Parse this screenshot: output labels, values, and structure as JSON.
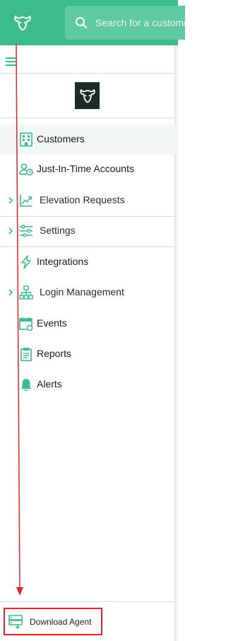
{
  "header": {
    "search_placeholder": "Search for a customer",
    "logo_icon": "bull-head-icon",
    "search_icon": "search-icon"
  },
  "sidebar": {
    "brand_logo": "bull-head-icon",
    "items": [
      {
        "label": "Customers",
        "icon": "building-grid-icon",
        "active": true,
        "expandable": false
      },
      {
        "label": "Just-In-Time Accounts",
        "icon": "user-clock-icon",
        "active": false,
        "expandable": false
      },
      {
        "label": "Elevation Requests",
        "icon": "chart-up-icon",
        "active": false,
        "expandable": true
      },
      {
        "label": "Settings",
        "icon": "sliders-icon",
        "active": false,
        "expandable": true
      },
      {
        "label": "Integrations",
        "icon": "lightning-icon",
        "active": false,
        "expandable": false
      },
      {
        "label": "Login Management",
        "icon": "hierarchy-icon",
        "active": false,
        "expandable": true
      },
      {
        "label": "Events",
        "icon": "calendar-icon",
        "active": false,
        "expandable": false
      },
      {
        "label": "Reports",
        "icon": "clipboard-icon",
        "active": false,
        "expandable": false
      },
      {
        "label": "Alerts",
        "icon": "bell-icon",
        "active": false,
        "expandable": false
      }
    ]
  },
  "footer": {
    "download_label": "Download Agent",
    "download_icon": "server-download-icon"
  },
  "colors": {
    "accent": "#3dbb8a",
    "highlight_box": "#e3242b",
    "arrow": "#e3242b"
  }
}
